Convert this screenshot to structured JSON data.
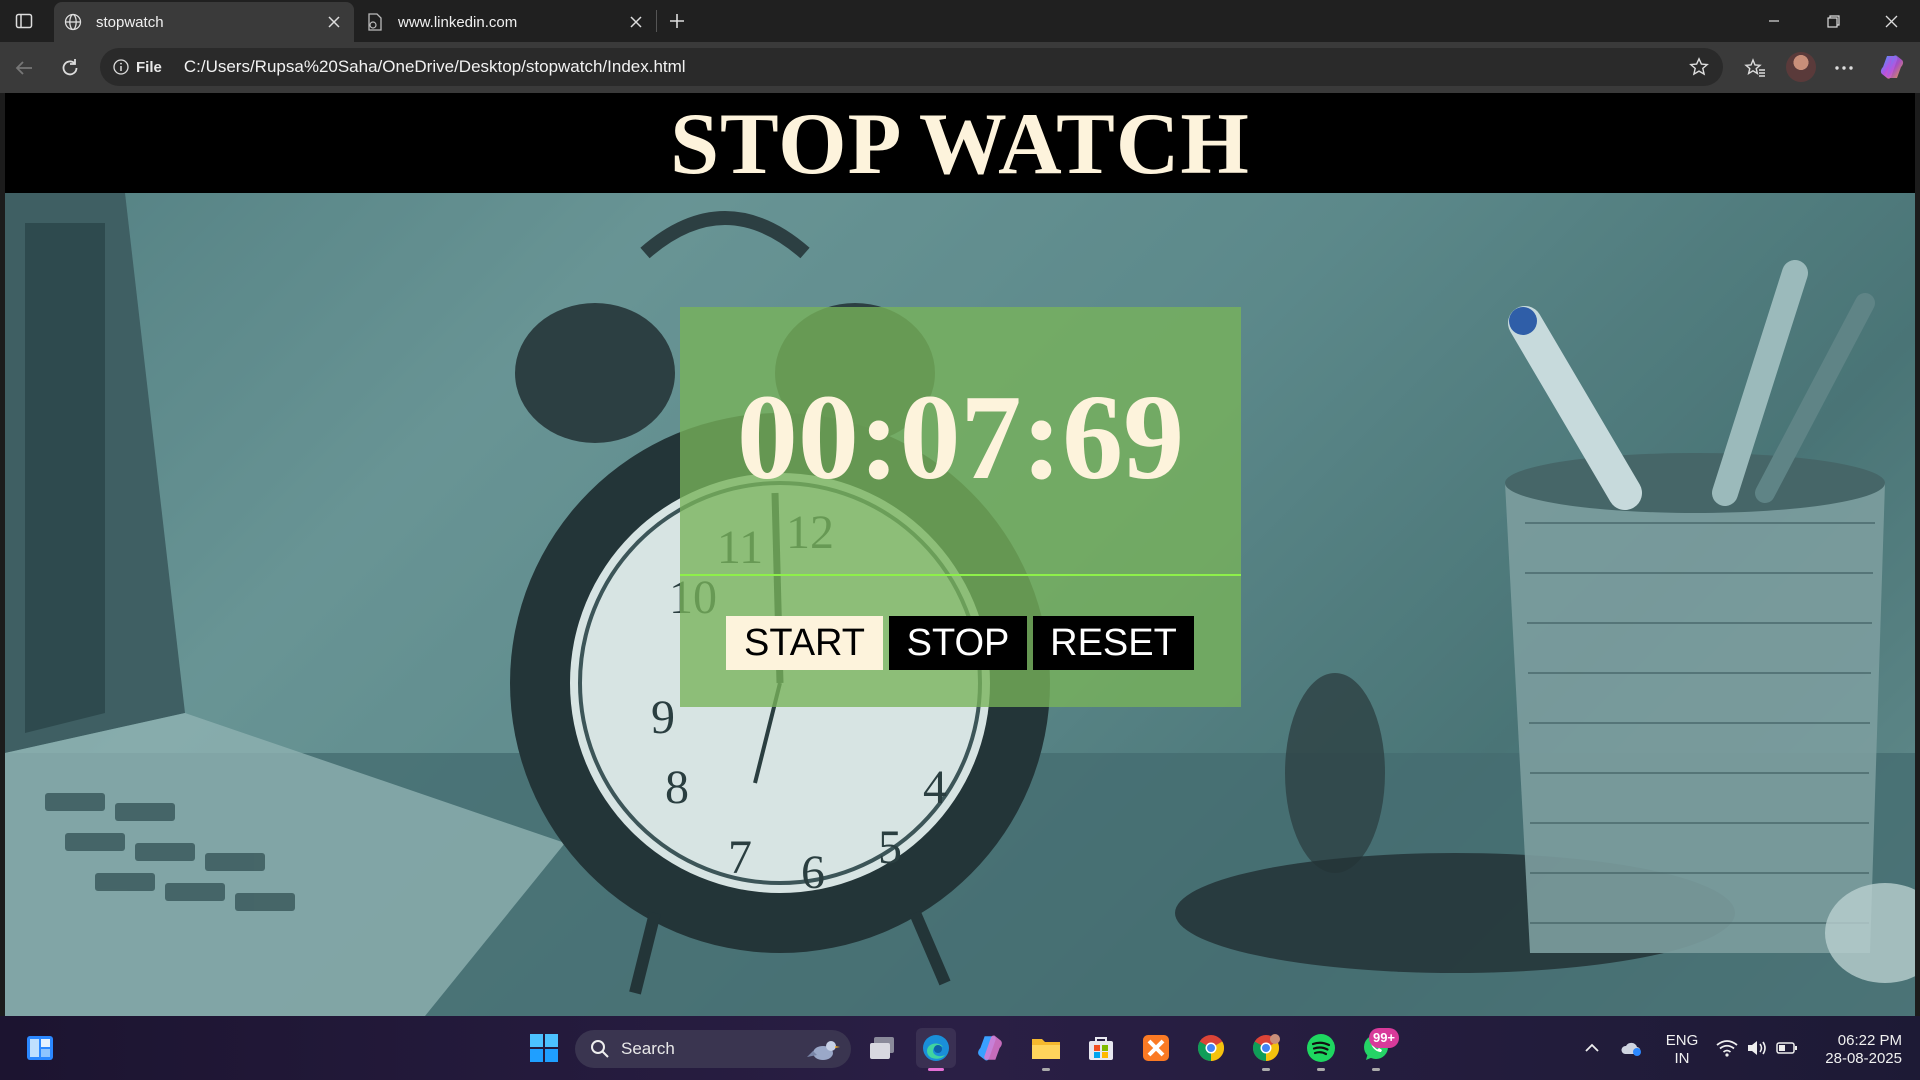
{
  "browser": {
    "tabs": [
      {
        "title": "stopwatch",
        "icon": "globe-icon",
        "active": true
      },
      {
        "title": "www.linkedin.com",
        "icon": "page-icon",
        "active": false
      }
    ],
    "address": {
      "scheme_label": "File",
      "url": "C:/Users/Rupsa%20Saha/OneDrive/Desktop/stopwatch/Index.html"
    }
  },
  "page": {
    "title": "STOP WATCH",
    "time": "00:07:69",
    "buttons": {
      "start": "START",
      "stop": "STOP",
      "reset": "RESET"
    }
  },
  "taskbar": {
    "search_label": "Search",
    "whatsapp_badge": "99+",
    "language": {
      "line1": "ENG",
      "line2": "IN"
    },
    "clock": {
      "time": "06:22 PM",
      "date": "28-08-2025"
    }
  },
  "colors": {
    "header_bg": "#000000",
    "title_text": "#fdf3dc",
    "panel_green": "#78b45a",
    "divider": "#8ef04a",
    "start_btn_bg": "#fdf3dc",
    "other_btn_bg": "#000000"
  }
}
